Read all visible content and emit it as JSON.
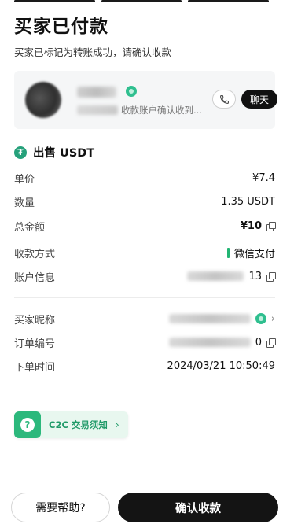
{
  "header": {
    "title": "买家已付款",
    "subtitle": "买家已标记为转账成功，请确认收款"
  },
  "counterparty": {
    "note": "收款账户确认收到...",
    "chat_label": "聊天",
    "icons": {
      "verified": "verified-badge-icon",
      "phone": "phone-icon"
    }
  },
  "asset": {
    "icon": "usdt-tether-icon",
    "label": "出售 USDT"
  },
  "details": {
    "price": {
      "label": "单价",
      "value": "¥7.4"
    },
    "quantity": {
      "label": "数量",
      "value": "1.35 USDT"
    },
    "total": {
      "label": "总金额",
      "value": "¥10"
    },
    "payment_method": {
      "label": "收款方式",
      "value": "微信支付"
    },
    "account_info": {
      "label": "账户信息",
      "value_tail": "13"
    }
  },
  "order": {
    "buyer_nickname": {
      "label": "买家昵称"
    },
    "order_number": {
      "label": "订单编号",
      "value_tail": "0"
    },
    "order_time": {
      "label": "下单时间",
      "value": "2024/03/21 10:50:49"
    }
  },
  "notice_banner": {
    "label": "C2C 交易须知",
    "chevron": "›"
  },
  "footer": {
    "help_label": "需要帮助?",
    "confirm_label": "确认收款"
  },
  "colors": {
    "accent_green": "#2cb87c",
    "tether_green": "#26a17b",
    "primary_button": "#141414"
  }
}
